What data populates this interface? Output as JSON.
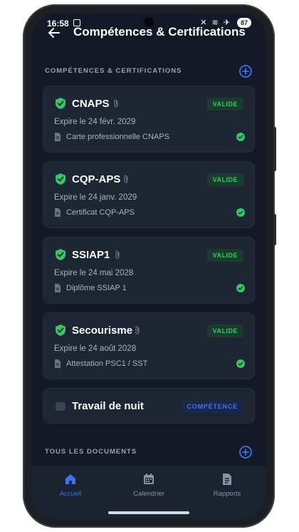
{
  "status": {
    "time": "16:58",
    "battery": "87"
  },
  "header": {
    "title": "Compétences & Certifications"
  },
  "sections": {
    "certs_title": "COMPÉTENCES & CERTIFICATIONS",
    "docs_title": "TOUS LES DOCUMENTS"
  },
  "certifications": [
    {
      "name": "CNAPS",
      "badge": "VALIDE",
      "expire": "Expire le 24 févr. 2029",
      "document": "Carte professionnelle CNAPS"
    },
    {
      "name": "CQP-APS",
      "badge": "VALIDE",
      "expire": "Expire le 24 janv. 2029",
      "document": "Certificat CQP-APS"
    },
    {
      "name": "SSIAP1",
      "badge": "VALIDE",
      "expire": "Expire le 24 mai 2028",
      "document": "Diplôme SSIAP 1"
    },
    {
      "name": "Secourisme",
      "badge": "VALIDE",
      "expire": "Expire le 24 août 2028",
      "document": "Attestation PSC1 / SST"
    }
  ],
  "competence": {
    "name": "Travail de nuit",
    "badge": "COMPÉTENCE"
  },
  "nav": [
    {
      "label": "Accueil",
      "icon": "home-icon",
      "active": true
    },
    {
      "label": "Calendrier",
      "icon": "calendar-icon",
      "active": false
    },
    {
      "label": "Rapports",
      "icon": "report-icon",
      "active": false
    }
  ],
  "colors": {
    "background": "#131926",
    "card": "#1e2533",
    "valid_green": "#37c46a",
    "accent_blue": "#3d73f0"
  }
}
